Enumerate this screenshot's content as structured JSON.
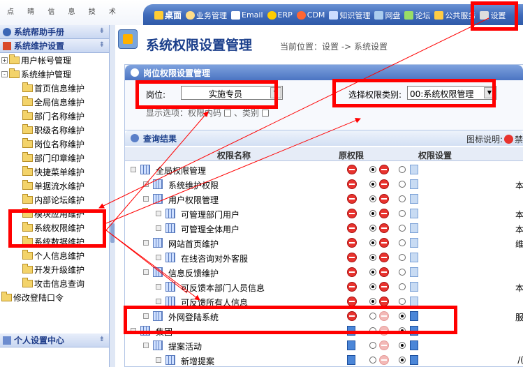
{
  "header": {
    "logo_text": "点 晴 信 息 技 术",
    "nav": [
      {
        "label": "桌面",
        "icon": "desktop-icon",
        "color": "#ffcc33"
      },
      {
        "label": "业务管理",
        "icon": "person-icon",
        "color": "#ffdd88"
      },
      {
        "label": "Email",
        "icon": "mail-icon",
        "color": "#ffffff"
      },
      {
        "label": "ERP",
        "icon": "erp-icon",
        "color": "#ffcc00"
      },
      {
        "label": "CDM",
        "icon": "cdm-icon",
        "color": "#ff6633"
      },
      {
        "label": "知识管理",
        "icon": "knowledge-icon",
        "color": "#ccddff"
      },
      {
        "label": "网盘",
        "icon": "disk-icon",
        "color": "#aaccee"
      },
      {
        "label": "论坛",
        "icon": "forum-icon",
        "color": "#99dd66"
      },
      {
        "label": "公共服务",
        "icon": "service-icon",
        "color": "#ffcc44"
      },
      {
        "label": "设置",
        "icon": "settings-icon",
        "color": "#dddddd"
      }
    ]
  },
  "sidebar": {
    "panel1_title": "系统帮助手册",
    "panel2_title": "系统维护设置",
    "panel3_title": "个人设置中心",
    "tree": [
      {
        "label": "用户帐号管理",
        "level": 0,
        "toggle": "+"
      },
      {
        "label": "系统维护管理",
        "level": 0,
        "toggle": "-"
      },
      {
        "label": "首页信息维护",
        "level": 1
      },
      {
        "label": "全局信息维护",
        "level": 1
      },
      {
        "label": "部门名称维护",
        "level": 1
      },
      {
        "label": "职级名称维护",
        "level": 1
      },
      {
        "label": "岗位名称维护",
        "level": 1
      },
      {
        "label": "部门印章维护",
        "level": 1
      },
      {
        "label": "快捷菜单维护",
        "level": 1
      },
      {
        "label": "单据流水维护",
        "level": 1
      },
      {
        "label": "内部论坛维护",
        "level": 1
      },
      {
        "label": "模块应用维护",
        "level": 1
      },
      {
        "label": "系统权限维护",
        "level": 1
      },
      {
        "label": "系统数据维护",
        "level": 1
      },
      {
        "label": "个人信息维护",
        "level": 1
      },
      {
        "label": "开发升级维护",
        "level": 1
      },
      {
        "label": "攻击信息查询",
        "level": 1
      },
      {
        "label": "修改登陆口令",
        "level": 0
      }
    ]
  },
  "main": {
    "title": "系统权限设置管理",
    "location": "当前位置：设置 -> 系统设置",
    "filter": {
      "section_title": "岗位权限设置管理",
      "position_label": "岗位:",
      "position_value": "实施专员",
      "type_label": "选择权限类别:",
      "type_value": "00:系统权限管理",
      "show_options_label": "显示选项：权限内码",
      "show_option2": "、类别"
    },
    "results": {
      "section_title": "查询结果",
      "legend_label": "图标说明:",
      "legend_item": "禁",
      "columns": {
        "name": "权限名称",
        "orig": "原权限",
        "set": "权限设置"
      },
      "rows": [
        {
          "label": "全局权限管理",
          "indent": 0,
          "orig": "stop",
          "r1": true,
          "s": "stop",
          "r2": false,
          "book": "light",
          "right": ""
        },
        {
          "label": "系统维护权限",
          "indent": 1,
          "orig": "stop",
          "r1": true,
          "s": "stop",
          "r2": false,
          "book": "light",
          "right": "本"
        },
        {
          "label": "用户权限管理",
          "indent": 1,
          "orig": "stop",
          "r1": true,
          "s": "stop",
          "r2": false,
          "book": "light",
          "right": ""
        },
        {
          "label": "可管理部门用户",
          "indent": 2,
          "orig": "stop",
          "r1": true,
          "s": "stop",
          "r2": false,
          "book": "light",
          "right": "本"
        },
        {
          "label": "可管理全体用户",
          "indent": 2,
          "orig": "stop",
          "r1": true,
          "s": "stop",
          "r2": false,
          "book": "light",
          "right": "本"
        },
        {
          "label": "网站首页维护",
          "indent": 1,
          "orig": "stop",
          "r1": true,
          "s": "stop",
          "r2": false,
          "book": "light",
          "right": "维"
        },
        {
          "label": "在线咨询对外客服",
          "indent": 2,
          "orig": "stop",
          "r1": true,
          "s": "stop",
          "r2": false,
          "book": "light",
          "right": ""
        },
        {
          "label": "信息反馈维护",
          "indent": 1,
          "orig": "stop",
          "r1": true,
          "s": "stop",
          "r2": false,
          "book": "light",
          "right": ""
        },
        {
          "label": "可反馈本部门人员信息",
          "indent": 2,
          "orig": "stop",
          "r1": true,
          "s": "stop",
          "r2": false,
          "book": "light",
          "right": "本"
        },
        {
          "label": "可反馈所有人信息",
          "indent": 2,
          "orig": "stop",
          "r1": true,
          "s": "stop",
          "r2": false,
          "book": "light",
          "right": ""
        },
        {
          "label": "外网登陆系统",
          "indent": 1,
          "orig": "stop",
          "r1": false,
          "s": "stopdim",
          "r2": true,
          "book": "dark",
          "right": "服"
        },
        {
          "label": "集团",
          "indent": 0,
          "orig": "book",
          "r1": false,
          "s": "stopdim",
          "r2": true,
          "book": "dark",
          "right": ""
        },
        {
          "label": "提案活动",
          "indent": 1,
          "orig": "book",
          "r1": false,
          "s": "stopdim",
          "r2": true,
          "book": "dark",
          "right": ""
        },
        {
          "label": "新增提案",
          "indent": 2,
          "orig": "book",
          "r1": false,
          "s": "stopdim",
          "r2": true,
          "book": "dark",
          "right": "/("
        }
      ]
    }
  }
}
